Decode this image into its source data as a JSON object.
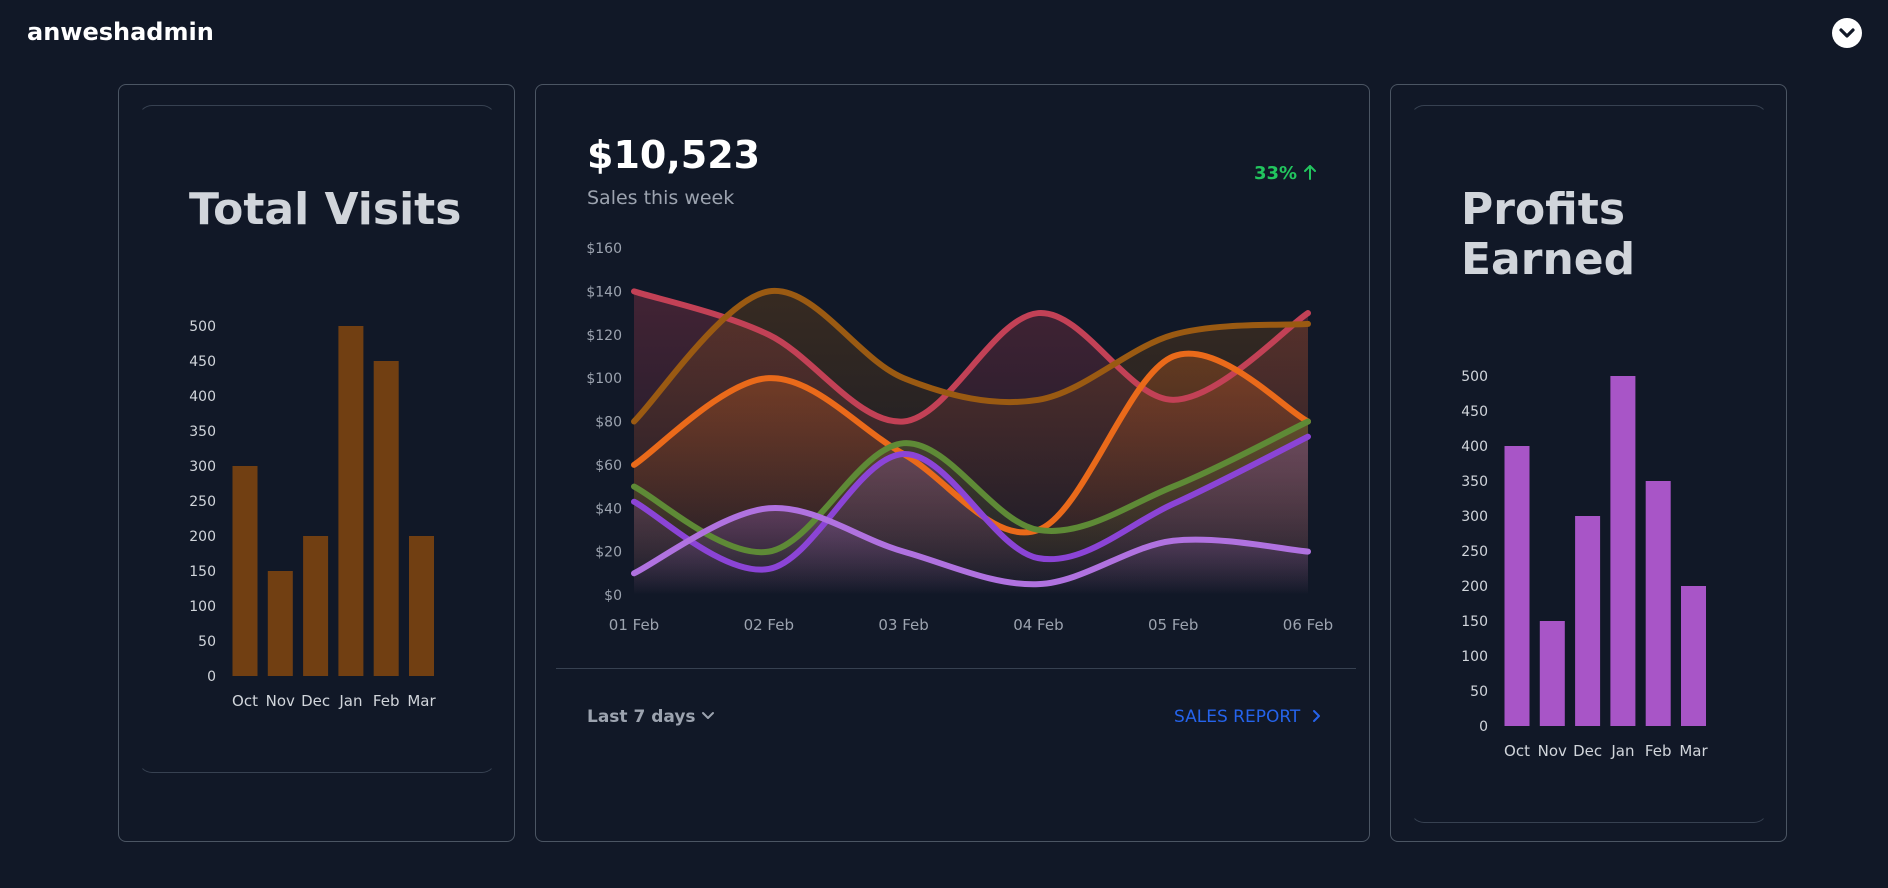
{
  "header": {
    "brand": "anweshadmin",
    "user_menu_icon": "chevron-down-icon"
  },
  "visits_card": {
    "title": "Total Visits"
  },
  "sales_card": {
    "amount": "$10,523",
    "subtitle": "Sales this week",
    "change": "33%",
    "change_icon": "arrow-up-icon",
    "period_label": "Last 7 days",
    "period_icon": "chevron-down-icon",
    "report_label": "SALES REPORT",
    "report_icon": "chevron-right-icon"
  },
  "profit_card": {
    "title_line1": "Profits",
    "title_line2": "Earned"
  },
  "colors": {
    "background": "#111827",
    "visits_bar": "#713f12",
    "profit_bar": "#a855c7",
    "positive": "#22c55e",
    "link": "#2563eb"
  },
  "chart_data": [
    {
      "type": "bar",
      "categories": [
        "Oct",
        "Nov",
        "Dec",
        "Jan",
        "Feb",
        "Mar"
      ],
      "values": [
        300,
        150,
        200,
        500,
        450,
        200
      ],
      "ylim": [
        0,
        500
      ],
      "yticks": [
        0,
        50,
        100,
        150,
        200,
        250,
        300,
        350,
        400,
        450,
        500
      ],
      "color": "#713f12"
    },
    {
      "type": "area",
      "x": [
        "01 Feb",
        "02 Feb",
        "03 Feb",
        "04 Feb",
        "05 Feb",
        "06 Feb"
      ],
      "ylim": [
        0,
        160
      ],
      "yticks": [
        "$0",
        "$20",
        "$40",
        "$60",
        "$80",
        "$100",
        "$120",
        "$140",
        "$160"
      ],
      "grid": false,
      "series": [
        {
          "color": "#c24156",
          "values": [
            140,
            120,
            80,
            130,
            90,
            130
          ]
        },
        {
          "color": "#9a5a12",
          "values": [
            80,
            140,
            100,
            90,
            120,
            125
          ]
        },
        {
          "color": "#ea6a1a",
          "values": [
            60,
            100,
            65,
            30,
            110,
            80
          ]
        },
        {
          "color": "#5e8a36",
          "values": [
            50,
            20,
            70,
            30,
            50,
            80
          ]
        },
        {
          "color": "#8b44d6",
          "values": [
            43,
            12,
            65,
            17,
            42,
            73
          ]
        },
        {
          "color": "#b072e0",
          "values": [
            10,
            40,
            20,
            5,
            25,
            20
          ]
        }
      ]
    },
    {
      "type": "bar",
      "categories": [
        "Oct",
        "Nov",
        "Dec",
        "Jan",
        "Feb",
        "Mar"
      ],
      "values": [
        400,
        150,
        300,
        500,
        350,
        200
      ],
      "ylim": [
        0,
        500
      ],
      "yticks": [
        0,
        50,
        100,
        150,
        200,
        250,
        300,
        350,
        400,
        450,
        500
      ],
      "color": "#a855c7"
    }
  ]
}
